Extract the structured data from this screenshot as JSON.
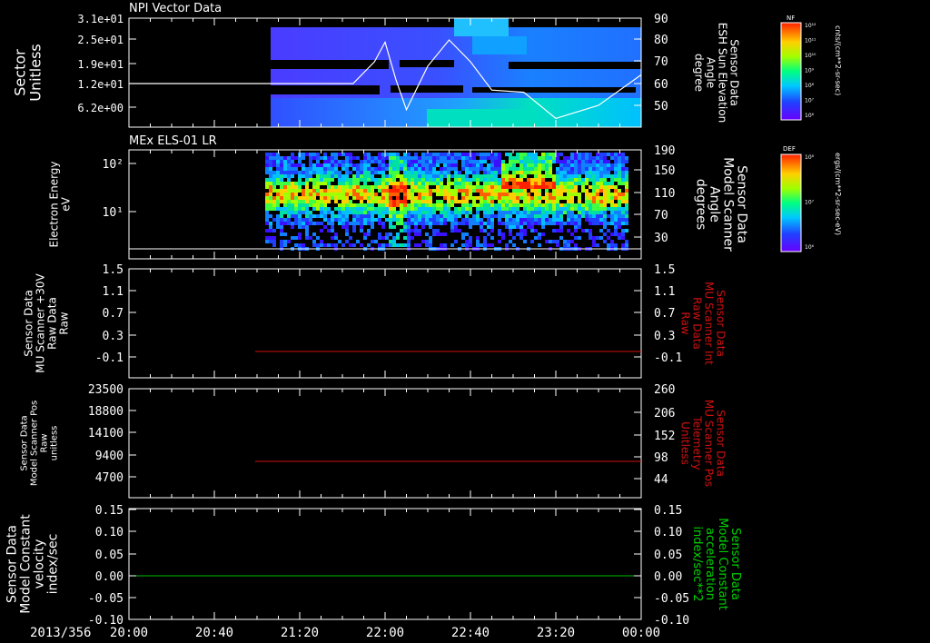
{
  "colors": {
    "background": "#000000",
    "frame": "#ffffff",
    "red_line": "#d01010",
    "green_line": "#00c000"
  },
  "footer": {
    "date_label": "2013/356",
    "time_ticks": [
      "20:00",
      "20:40",
      "21:20",
      "22:00",
      "22:40",
      "23:20",
      "00:00"
    ]
  },
  "colorbars": [
    {
      "title": "NF",
      "ticks": [
        "10¹²",
        "10¹¹",
        "10¹⁰",
        "10⁹",
        "10⁸",
        "10⁷",
        "10⁶"
      ],
      "unit": "cnts/(cm**2-sr-sec)"
    },
    {
      "title": "DEF",
      "ticks": [
        "10⁸",
        "10⁷",
        "10⁶"
      ],
      "unit": "ergs/(cm**2-sr-sec-eV)"
    }
  ],
  "chart_data": [
    {
      "type": "heatmap",
      "title": "NPI Vector Data",
      "ylabel": [
        "Sector",
        "Unitless"
      ],
      "yticks": [
        "3.1e+01",
        "2.5e+01",
        "1.9e+01",
        "1.2e+01",
        "6.2e+00"
      ],
      "y2label": [
        "Sensor Data",
        "ESH Sun Elevation",
        "Angle",
        "degree"
      ],
      "y2ticks": [
        "90",
        "80",
        "70",
        "60",
        "50"
      ],
      "y2lim": [
        40,
        90
      ],
      "overlay_line": {
        "x": [
          "20:00",
          "21:25",
          "21:45",
          "21:55",
          "22:00",
          "22:05",
          "22:10",
          "22:20",
          "22:30",
          "22:40",
          "22:50",
          "23:05",
          "23:20",
          "23:40",
          "00:00"
        ],
        "y": [
          60,
          60,
          60,
          70,
          79,
          62,
          48,
          68,
          80,
          70,
          57,
          56,
          44,
          50,
          64
        ]
      }
    },
    {
      "type": "heatmap",
      "title": "MEx ELS-01 LR",
      "ylabel": [
        "Electron Energy",
        "eV"
      ],
      "yticks": [
        "10²",
        "10¹"
      ],
      "y2label": [
        "Sensor Data",
        "Model Scanner",
        "Angle",
        "degrees"
      ],
      "y2ticks": [
        "190",
        "150",
        "110",
        "70",
        "30"
      ]
    },
    {
      "type": "line",
      "ylabel": [
        "Sensor Data",
        "MU Scanner +30V",
        "Raw Data",
        "Raw"
      ],
      "yticks": [
        "1.5",
        "1.1",
        "0.7",
        "0.3",
        "-0.1"
      ],
      "ylim": [
        -0.3,
        1.5
      ],
      "y2label": [
        "Sensor Data",
        "MU Scanner Int",
        "Raw Data",
        "Raw"
      ],
      "y2ticks": [
        "1.5",
        "1.1",
        "0.7",
        "0.3",
        "-0.1"
      ],
      "series": [
        {
          "x": [
            "21:05",
            "00:00"
          ],
          "y": [
            0.0,
            0.0
          ],
          "color": "#d01010"
        }
      ]
    },
    {
      "type": "line",
      "ylabel": [
        "Sensor Data",
        "Model Scanner Pos",
        "Raw",
        "unitless"
      ],
      "yticks": [
        "23500",
        "18800",
        "14100",
        "9400",
        "4700"
      ],
      "ylim": [
        0,
        23500
      ],
      "y2label": [
        "Sensor Data",
        "MU Scanner Pos",
        "Telemetry",
        "Unitless"
      ],
      "y2ticks": [
        "260",
        "206",
        "152",
        "98",
        "44"
      ],
      "series": [
        {
          "x": [
            "21:05",
            "00:00"
          ],
          "y": [
            8000,
            8000
          ],
          "color": "#d01010"
        }
      ]
    },
    {
      "type": "line",
      "ylabel": [
        "Sensor Data",
        "Model Constant",
        "velocity",
        "index/sec"
      ],
      "yticks": [
        "0.15",
        "0.10",
        "0.05",
        "0.00",
        "-0.05",
        "-0.10"
      ],
      "ylim": [
        -0.1,
        0.15
      ],
      "y2label": [
        "Sensor Data",
        "Model Constant",
        "acceleration",
        "index/sec**2"
      ],
      "y2ticks": [
        "0.15",
        "0.10",
        "0.05",
        "0.00",
        "-0.05",
        "-0.10"
      ],
      "series": [
        {
          "x": [
            "20:00",
            "00:00"
          ],
          "y": [
            0.0,
            0.0
          ],
          "color": "#00c000"
        }
      ]
    }
  ]
}
